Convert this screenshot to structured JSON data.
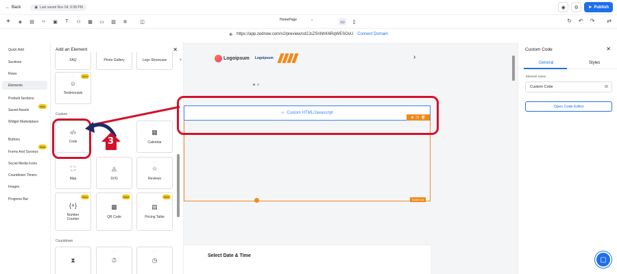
{
  "topbar": {
    "back_label": "Back",
    "saved_text": "Last saved Nov 04, 6:08 PM",
    "publish_label": "Publish"
  },
  "toolbar": {
    "page_name": "HomePage",
    "icons": [
      "layers-icon",
      "page-icon",
      "code-icon",
      "save-icon",
      "text-icon",
      "people-icon",
      "calendar-icon",
      "doc-icon",
      "image-icon",
      "settings-icon",
      "layout-icon"
    ]
  },
  "url": {
    "address": "https://app.zednow.com/v2/preview/cd2JcZSnNhK6RqWESOvU",
    "connect_label": "Connect Domain"
  },
  "leftnav": {
    "items": [
      "Quick Add",
      "Sections",
      "Rows",
      "Elements",
      "Prebuilt Sections",
      "Saved Assets",
      "Widget Marketplace",
      "Buttons",
      "Forms And Surveys",
      "Social Media Icons",
      "Countdown Timers",
      "Images",
      "Progress Bar"
    ],
    "new_badge": "New"
  },
  "panel": {
    "title": "Add an Element",
    "custom_section": "Custom",
    "countdown_section": "Countdown",
    "top_row": [
      "FAQ",
      "Photo Gallery",
      "Logo Showcase"
    ],
    "testimonials": "Testimonials",
    "cards": [
      "Code",
      "Calendar",
      "Map",
      "SVG",
      "Reviews",
      "Number Counter",
      "QR Code",
      "Pricing Table"
    ]
  },
  "canvas": {
    "logo_text": "Logoipsum",
    "logo_text2": "Logoipsum",
    "html_block_label": "Custom HTML/Javascript",
    "bullet_list": "Bullet List",
    "date_title": "Select Date & Time"
  },
  "rpanel": {
    "title": "Custom Code",
    "tab_general": "General",
    "tab_styles": "Styles",
    "element_name_label": "Element name",
    "element_name_value": "Custom Code",
    "open_editor": "Open Code Editor"
  },
  "annotation": {
    "step_number": "3",
    "color": "#d3112b"
  },
  "colors": {
    "accent": "#1f6feb",
    "orange": "#f08a1d",
    "badge": "#f5c518"
  }
}
